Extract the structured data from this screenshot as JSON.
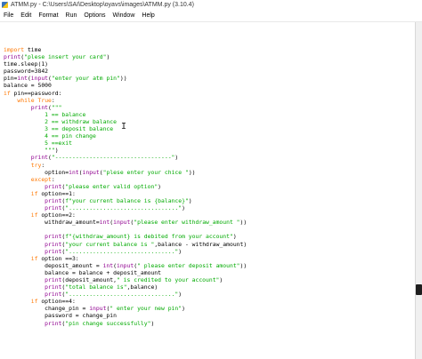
{
  "window": {
    "title": "ATMM.py - C:\\Users\\SAI\\Desktop\\oyavs\\images\\ATMM.py (3.10.4)"
  },
  "menu": [
    "File",
    "Edit",
    "Format",
    "Run",
    "Options",
    "Window",
    "Help"
  ],
  "colors": {
    "keyword": "#ff7700",
    "builtin": "#900090",
    "string": "#00aa00",
    "default": "#000000"
  },
  "code_lines": [
    [
      [
        "kw",
        "import"
      ],
      [
        "df",
        " time"
      ]
    ],
    [
      [
        "bi",
        "print"
      ],
      [
        "df",
        "("
      ],
      [
        "str",
        "\"plese insert your card\""
      ],
      [
        "df",
        ")"
      ]
    ],
    [
      [
        "df",
        "time.sleep(1)"
      ]
    ],
    [
      [
        "df",
        "password=3842"
      ]
    ],
    [
      [
        "df",
        "pin="
      ],
      [
        "bi",
        "int"
      ],
      [
        "df",
        "("
      ],
      [
        "bi",
        "input"
      ],
      [
        "df",
        "("
      ],
      [
        "str",
        "\"enter your atm pin\""
      ],
      [
        "df",
        "))"
      ]
    ],
    [
      [
        "df",
        "balance = 5000"
      ]
    ],
    [
      [
        "kw",
        "if"
      ],
      [
        "df",
        " pin==password:"
      ]
    ],
    [
      [
        "df",
        "    "
      ],
      [
        "kw",
        "while"
      ],
      [
        "df",
        " "
      ],
      [
        "kw",
        "True"
      ],
      [
        "df",
        ":"
      ]
    ],
    [
      [
        "df",
        "        "
      ],
      [
        "bi",
        "print"
      ],
      [
        "df",
        "("
      ],
      [
        "str",
        "\"\"\""
      ]
    ],
    [
      [
        "str",
        "            1 == balance"
      ]
    ],
    [
      [
        "str",
        "            2 == withdraw balance"
      ]
    ],
    [
      [
        "str",
        "            3 == deposit balance"
      ]
    ],
    [
      [
        "str",
        "            4 == pin change"
      ]
    ],
    [
      [
        "str",
        "            5 ==exit"
      ]
    ],
    [
      [
        "str",
        "            \"\"\""
      ],
      [
        "df",
        ")"
      ]
    ],
    [
      [
        "df",
        "        "
      ],
      [
        "bi",
        "print"
      ],
      [
        "df",
        "("
      ],
      [
        "str",
        "\"----------------------------------\""
      ],
      [
        "df",
        ")"
      ]
    ],
    [
      [
        "df",
        "        "
      ],
      [
        "kw",
        "try"
      ],
      [
        "df",
        ":"
      ]
    ],
    [
      [
        "df",
        "            option="
      ],
      [
        "bi",
        "int"
      ],
      [
        "df",
        "("
      ],
      [
        "bi",
        "input"
      ],
      [
        "df",
        "("
      ],
      [
        "str",
        "\"plese enter your chice \""
      ],
      [
        "df",
        "))"
      ]
    ],
    [
      [
        "df",
        "        "
      ],
      [
        "kw",
        "except"
      ],
      [
        "df",
        ":"
      ]
    ],
    [
      [
        "df",
        "            "
      ],
      [
        "bi",
        "print"
      ],
      [
        "df",
        "("
      ],
      [
        "str",
        "\"please enter valid option\""
      ],
      [
        "df",
        ")"
      ]
    ],
    [
      [
        "df",
        "        "
      ],
      [
        "kw",
        "if"
      ],
      [
        "df",
        " option==1:"
      ]
    ],
    [
      [
        "df",
        "            "
      ],
      [
        "bi",
        "print"
      ],
      [
        "df",
        "("
      ],
      [
        "str",
        "f\"your current balance is {balance}\""
      ],
      [
        "df",
        ")"
      ]
    ],
    [
      [
        "df",
        "            "
      ],
      [
        "bi",
        "print"
      ],
      [
        "df",
        "("
      ],
      [
        "str",
        "\"................................\""
      ],
      [
        "df",
        ")"
      ]
    ],
    [
      [
        "df",
        "        "
      ],
      [
        "kw",
        "if"
      ],
      [
        "df",
        " option==2:"
      ]
    ],
    [
      [
        "df",
        "            withdraw_amount="
      ],
      [
        "bi",
        "int"
      ],
      [
        "df",
        "("
      ],
      [
        "bi",
        "input"
      ],
      [
        "df",
        "("
      ],
      [
        "str",
        "\"please enter withdraw_amount \""
      ],
      [
        "df",
        "))"
      ]
    ],
    [
      [
        "df",
        ""
      ]
    ],
    [
      [
        "df",
        "            "
      ],
      [
        "bi",
        "print"
      ],
      [
        "df",
        "("
      ],
      [
        "str",
        "f\"{withdraw_amount} is debited from your account\""
      ],
      [
        "df",
        ")"
      ]
    ],
    [
      [
        "df",
        "            "
      ],
      [
        "bi",
        "print"
      ],
      [
        "df",
        "("
      ],
      [
        "str",
        "\"your current balance is \""
      ],
      [
        "df",
        ",balance - withdraw_amount)"
      ]
    ],
    [
      [
        "df",
        "            "
      ],
      [
        "bi",
        "print"
      ],
      [
        "df",
        "("
      ],
      [
        "str",
        "\"...............................\""
      ],
      [
        "df",
        ")"
      ]
    ],
    [
      [
        "df",
        "        "
      ],
      [
        "kw",
        "if"
      ],
      [
        "df",
        " option ==3:"
      ]
    ],
    [
      [
        "df",
        "            deposit_amount = "
      ],
      [
        "bi",
        "int"
      ],
      [
        "df",
        "("
      ],
      [
        "bi",
        "input"
      ],
      [
        "df",
        "("
      ],
      [
        "str",
        "\" please enter deposit amount\""
      ],
      [
        "df",
        "))"
      ]
    ],
    [
      [
        "df",
        "            balance = balance + deposit_amount"
      ]
    ],
    [
      [
        "df",
        "            "
      ],
      [
        "bi",
        "print"
      ],
      [
        "df",
        "(deposit_amount,"
      ],
      [
        "str",
        "\" is credited to your account\""
      ],
      [
        "df",
        ")"
      ]
    ],
    [
      [
        "df",
        "            "
      ],
      [
        "bi",
        "print"
      ],
      [
        "df",
        "("
      ],
      [
        "str",
        "\"total balance is\""
      ],
      [
        "df",
        ",balance)"
      ]
    ],
    [
      [
        "df",
        "            "
      ],
      [
        "bi",
        "print"
      ],
      [
        "df",
        "("
      ],
      [
        "str",
        "\"...............................\""
      ],
      [
        "df",
        ")"
      ]
    ],
    [
      [
        "df",
        "        "
      ],
      [
        "kw",
        "if"
      ],
      [
        "df",
        " option==4:"
      ]
    ],
    [
      [
        "df",
        "            change_pin = "
      ],
      [
        "bi",
        "input"
      ],
      [
        "df",
        "("
      ],
      [
        "str",
        "\" enter your new pin\""
      ],
      [
        "df",
        ")"
      ]
    ],
    [
      [
        "df",
        "            password = change_pin"
      ]
    ],
    [
      [
        "df",
        "            "
      ],
      [
        "bi",
        "print"
      ],
      [
        "df",
        "("
      ],
      [
        "str",
        "\"pin change successfully\""
      ],
      [
        "df",
        ")"
      ]
    ]
  ]
}
